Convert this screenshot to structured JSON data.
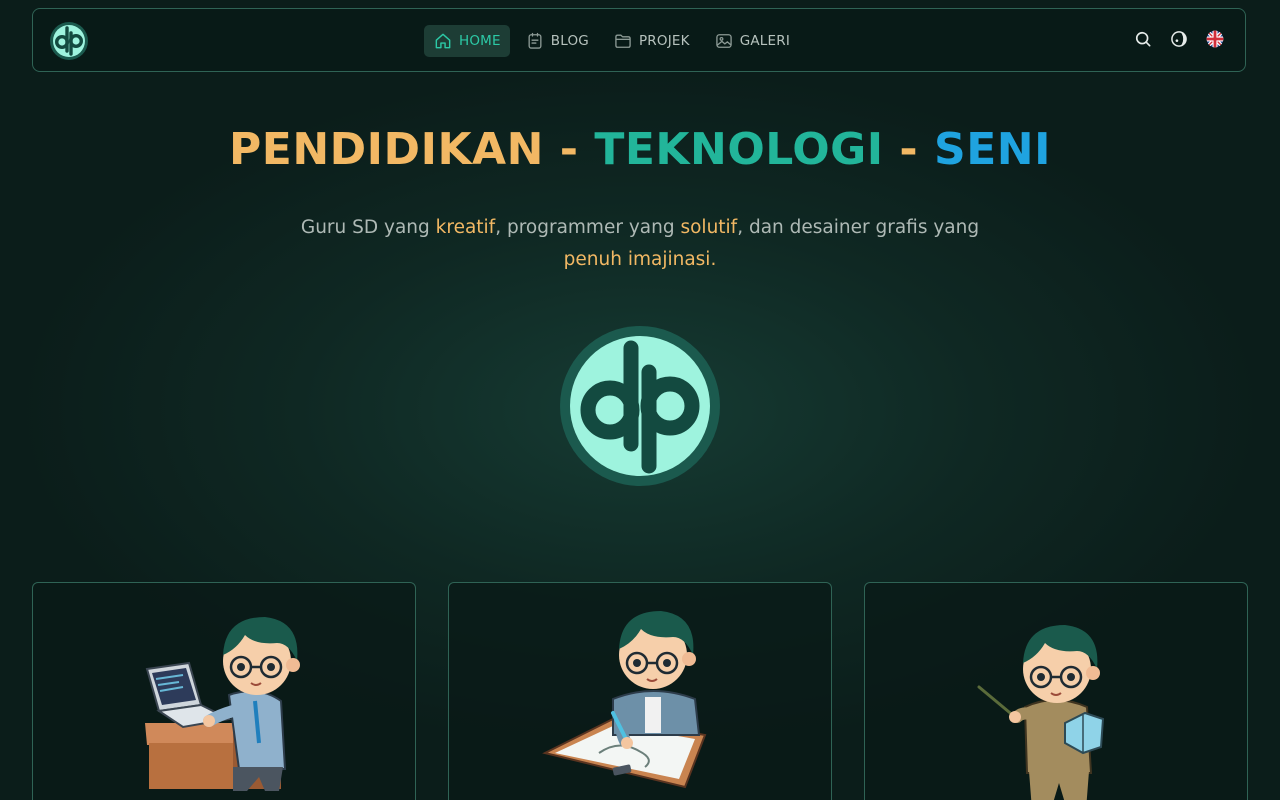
{
  "brand": {
    "logo_text": "dp"
  },
  "nav": {
    "links": [
      {
        "label": "HOME",
        "icon": "home-icon",
        "active": true
      },
      {
        "label": "BLOG",
        "icon": "notebook-icon",
        "active": false
      },
      {
        "label": "PROJEK",
        "icon": "folder-icon",
        "active": false
      },
      {
        "label": "GALERI",
        "icon": "image-icon",
        "active": false
      }
    ],
    "actions": [
      {
        "name": "search",
        "icon": "search-icon"
      },
      {
        "name": "theme",
        "icon": "theme-toggle-icon"
      },
      {
        "name": "language",
        "icon": "uk-flag-icon"
      }
    ]
  },
  "hero": {
    "title": {
      "part1": "PENDIDIKAN",
      "sep1": " - ",
      "part2": "TEKNOLOGI",
      "sep2": " - ",
      "part3": "SENI"
    },
    "subtitle": {
      "s1": "Guru SD yang ",
      "h1": "kreatif",
      "s2": ", programmer yang ",
      "h2": "solutif",
      "s3": ", dan desainer grafis yang ",
      "h3": "penuh imajinasi",
      "s4": "."
    }
  },
  "cards": [
    {
      "illustration": "programmer-illustration"
    },
    {
      "illustration": "designer-illustration"
    },
    {
      "illustration": "teacher-illustration"
    }
  ],
  "colors": {
    "accent_orange": "#f2b864",
    "accent_green": "#22b59a",
    "accent_blue": "#1fa3e0",
    "logo_mint": "#9ef3de",
    "border": "#2f6355"
  }
}
